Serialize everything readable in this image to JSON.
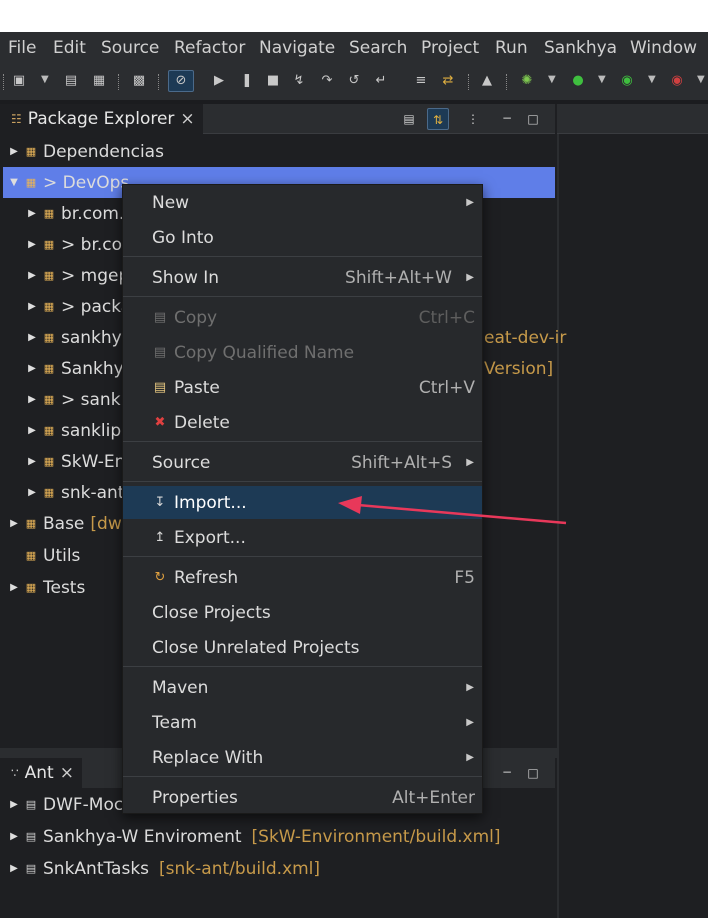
{
  "menubar": [
    "File",
    "Edit",
    "Source",
    "Refactor",
    "Navigate",
    "Search",
    "Project",
    "Run",
    "Sankhya",
    "Window"
  ],
  "package_explorer": {
    "tab_label": "Package Explorer",
    "close_glyph": "×",
    "items": [
      {
        "label": "Dependencias",
        "extra": "",
        "indent": 0,
        "expanded": false,
        "selected": false
      },
      {
        "label": "> DevOps",
        "extra": "",
        "indent": 0,
        "expanded": true,
        "selected": true
      },
      {
        "label": "br.com.",
        "extra": "",
        "indent": 1,
        "expanded": false,
        "selected": false
      },
      {
        "label": "> br.cor",
        "extra": "",
        "indent": 1,
        "expanded": false,
        "selected": false
      },
      {
        "label": "> mgep",
        "extra": "",
        "indent": 1,
        "expanded": false,
        "selected": false
      },
      {
        "label": "> packa",
        "extra": "",
        "indent": 1,
        "expanded": false,
        "selected": false
      },
      {
        "label": "sankhya",
        "extra": "eat-dev-ir",
        "indent": 1,
        "expanded": false,
        "selected": false
      },
      {
        "label": "Sankhy",
        "extra": "Version]",
        "indent": 1,
        "expanded": false,
        "selected": false
      },
      {
        "label": "> sankli",
        "extra": "",
        "indent": 1,
        "expanded": false,
        "selected": false
      },
      {
        "label": "sanklips",
        "extra": "",
        "indent": 1,
        "expanded": false,
        "selected": false
      },
      {
        "label": "SkW-En",
        "extra": "",
        "indent": 1,
        "expanded": false,
        "selected": false
      },
      {
        "label": "snk-ant",
        "extra": "",
        "indent": 1,
        "expanded": false,
        "selected": false
      },
      {
        "label": "Base",
        "extra": "[dwf",
        "indent": 0,
        "expanded": false,
        "selected": false
      },
      {
        "label": "Utils",
        "extra": "",
        "indent": 0,
        "expanded": null,
        "selected": false
      },
      {
        "label": "Tests",
        "extra": "",
        "indent": 0,
        "expanded": false,
        "selected": false
      }
    ]
  },
  "ant": {
    "tab_label": "Ant",
    "close_glyph": "×",
    "items": [
      {
        "label": "DWF-Moc",
        "extra": ""
      },
      {
        "label": "Sankhya-W Enviroment",
        "extra": "[SkW-Environment/build.xml]"
      },
      {
        "label": "SnkAntTasks",
        "extra": "[snk-ant/build.xml]"
      }
    ]
  },
  "context_menu": {
    "items": [
      {
        "label": "New",
        "accel": "",
        "submenu": true,
        "icon": "",
        "disabled": false
      },
      {
        "label": "Go Into",
        "accel": "",
        "submenu": false,
        "icon": "",
        "disabled": false
      },
      {
        "sep": true
      },
      {
        "label": "Show In",
        "accel": "Shift+Alt+W",
        "submenu": true,
        "icon": "",
        "disabled": false
      },
      {
        "sep": true
      },
      {
        "label": "Copy",
        "accel": "Ctrl+C",
        "submenu": false,
        "icon": "copy-icon",
        "disabled": true
      },
      {
        "label": "Copy Qualified Name",
        "accel": "",
        "submenu": false,
        "icon": "copy-qualified-icon",
        "disabled": true
      },
      {
        "label": "Paste",
        "accel": "Ctrl+V",
        "submenu": false,
        "icon": "paste-icon",
        "disabled": false
      },
      {
        "label": "Delete",
        "accel": "",
        "submenu": false,
        "icon": "delete-icon",
        "disabled": false
      },
      {
        "sep": true
      },
      {
        "label": "Source",
        "accel": "Shift+Alt+S",
        "submenu": true,
        "icon": "",
        "disabled": false
      },
      {
        "sep": true
      },
      {
        "label": "Import...",
        "accel": "",
        "submenu": false,
        "icon": "import-icon",
        "disabled": false,
        "highlight": true
      },
      {
        "label": "Export...",
        "accel": "",
        "submenu": false,
        "icon": "export-icon",
        "disabled": false
      },
      {
        "sep": true
      },
      {
        "label": "Refresh",
        "accel": "F5",
        "submenu": false,
        "icon": "refresh-icon",
        "disabled": false
      },
      {
        "label": "Close Projects",
        "accel": "",
        "submenu": false,
        "icon": "",
        "disabled": false
      },
      {
        "label": "Close Unrelated Projects",
        "accel": "",
        "submenu": false,
        "icon": "",
        "disabled": false
      },
      {
        "sep": true
      },
      {
        "label": "Maven",
        "accel": "",
        "submenu": true,
        "icon": "",
        "disabled": false
      },
      {
        "label": "Team",
        "accel": "",
        "submenu": true,
        "icon": "",
        "disabled": false
      },
      {
        "label": "Replace With",
        "accel": "",
        "submenu": true,
        "icon": "",
        "disabled": false
      },
      {
        "sep": true
      },
      {
        "label": "Properties",
        "accel": "Alt+Enter",
        "submenu": false,
        "icon": "",
        "disabled": false
      }
    ]
  },
  "colors": {
    "selection": "#5f7ee8",
    "menu_highlight": "#1d3a55",
    "arrow": "#e8385a",
    "decoration": "#c79a4a"
  }
}
